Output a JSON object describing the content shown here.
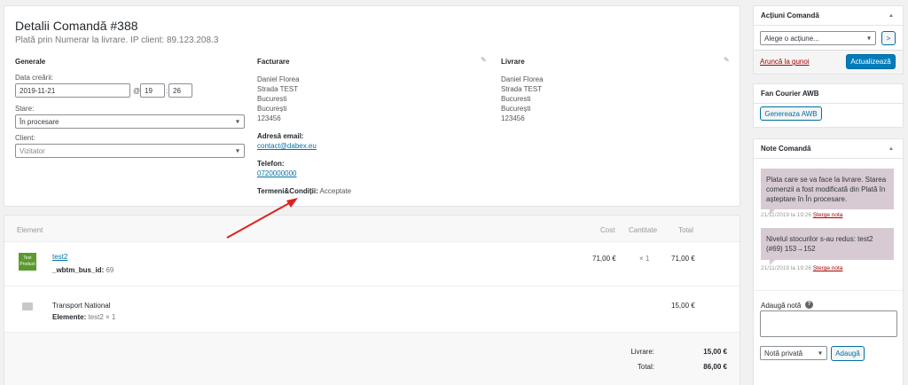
{
  "order": {
    "title": "Detalii Comandă #388",
    "subtitle": "Plată prin Numerar la livrare. IP client: 89.123.208.3"
  },
  "general": {
    "heading": "Generale",
    "date_label": "Data creării:",
    "date_value": "2019-11-21",
    "at_symbol": "@",
    "hour_value": "19",
    "minute_value": "26",
    "colon": ":",
    "status_label": "Stare:",
    "status_value": "În procesare",
    "client_label": "Client:",
    "client_value": "Vizitator"
  },
  "billing": {
    "heading": "Facturare",
    "name": "Daniel Florea",
    "street": "Strada TEST",
    "city": "Bucuresti",
    "county": "București",
    "zip": "123456",
    "email_label": "Adresă email:",
    "email_value": "contact@dabex.eu",
    "phone_label": "Telefon:",
    "phone_value": "0720000000",
    "terms_label": "Termeni&Condiții:",
    "terms_value": "Acceptate"
  },
  "shipping": {
    "heading": "Livrare",
    "name": "Daniel Florea",
    "street": "Strada TEST",
    "city": "Bucuresti",
    "county": "București",
    "zip": "123456"
  },
  "items": {
    "col_element": "Element",
    "col_cost": "Cost",
    "col_qty": "Cantitate",
    "col_total": "Total",
    "thumb_text": "Test Product",
    "product_name": "test2",
    "meta_key": "_wbtm_bus_id:",
    "meta_value": "69",
    "product_cost": "71,00 €",
    "product_qty": "× 1",
    "product_total": "71,00 €",
    "shipping_name": "Transport National",
    "shipping_items_label": "Elemente:",
    "shipping_items_value": "test2 × 1",
    "shipping_total": "15,00 €",
    "delivery_label": "Livrare:",
    "delivery_value": "15,00 €",
    "total_label": "Total:",
    "total_value": "86,00 €"
  },
  "actions": {
    "heading": "Acțiuni Comandă",
    "select_value": "Alege o acțiune...",
    "go_label": ">",
    "trash_label": "Aruncă la gunoi",
    "update_label": "Actualizează"
  },
  "awb": {
    "heading": "Fan Courier AWB",
    "button_label": "Genereaza AWB"
  },
  "notes": {
    "heading": "Note Comandă",
    "note1_text": "Plata care se va face la livrare. Starea comenzii a fost modificată din Plată în așteptare în În procesare.",
    "note1_date": "21/11/2019 la 19:26",
    "note2_text": "Nivelul stocurilor s-au redus: test2 (#69) 153→152",
    "note2_date": "21/11/2019 la 19:26",
    "delete_label": "Șterge nota",
    "add_label": "Adaugă notă",
    "help_icon": "?",
    "type_value": "Notă privată",
    "add_button": "Adaugă"
  },
  "colors": {
    "accent": "#007cba",
    "note_bg": "#d7cad2",
    "arrow": "#e02020"
  }
}
